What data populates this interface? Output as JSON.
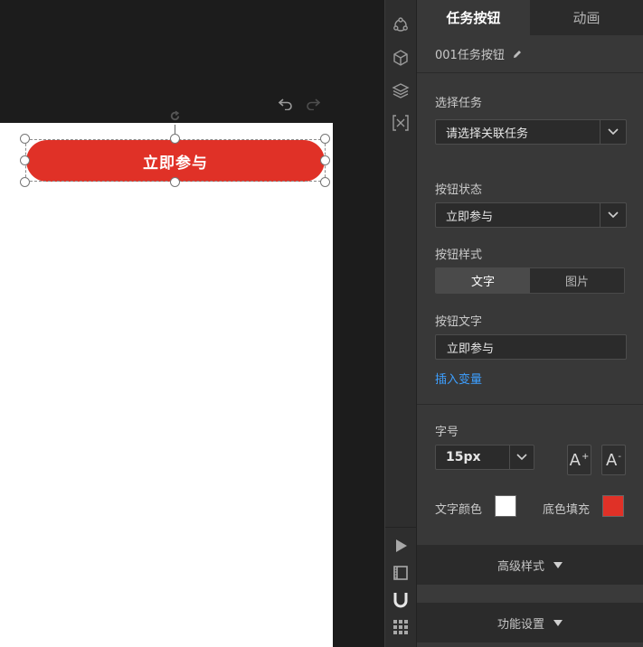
{
  "toolbar": {
    "undo_icon": "undo-icon",
    "redo_icon": "redo-icon"
  },
  "canvas": {
    "button_text": "立即参与",
    "button_color": "#e03127",
    "rotate_icon": "rotate-icon"
  },
  "tool_strip": {
    "top_icons": [
      "share-icon",
      "cube-icon",
      "layers-icon",
      "variable-icon"
    ],
    "bottom_icons": [
      "play-icon",
      "film-icon",
      "magnet-icon",
      "grid-icon"
    ]
  },
  "panel": {
    "tabs": [
      {
        "label": "任务按钮",
        "active": true
      },
      {
        "label": "动画",
        "active": false
      }
    ],
    "component_name": "001任务按钮",
    "select_task": {
      "label": "选择任务",
      "value": "请选择关联任务"
    },
    "button_state": {
      "label": "按钮状态",
      "value": "立即参与"
    },
    "button_style": {
      "label": "按钮样式",
      "options": [
        "文字",
        "图片"
      ],
      "selected": "文字"
    },
    "button_text": {
      "label": "按钮文字",
      "value": "立即参与"
    },
    "insert_variable": "插入变量",
    "font_size": {
      "label": "字号",
      "value": "15px",
      "increase": "A",
      "increase_sup": "+",
      "decrease": "A",
      "decrease_sup": "-"
    },
    "text_color": {
      "label": "文字颜色",
      "color": "#ffffff"
    },
    "fill_color": {
      "label": "底色填充",
      "color": "#e03127"
    },
    "advanced_style": "高级样式",
    "function_settings": "功能设置"
  }
}
